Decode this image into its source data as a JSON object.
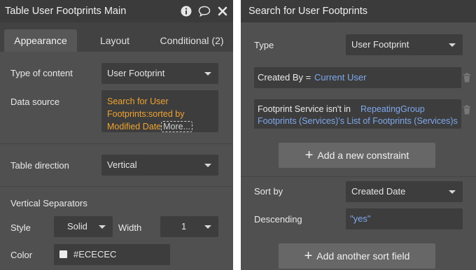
{
  "left_panel": {
    "title": "Table User Footprints Main",
    "tabs": [
      "Appearance",
      "Layout",
      "Conditional (2)"
    ],
    "type_of_content_label": "Type of content",
    "type_of_content_value": "User Footprint",
    "data_source_label": "Data source",
    "data_source_value": "Search for User Footprints:sorted by Modified Date",
    "data_source_line1": "Search for User",
    "data_source_line2": "Footprints:sorted by",
    "data_source_line3": "Modified Date",
    "more_link": "More...",
    "table_direction_label": "Table direction",
    "table_direction_value": "Vertical",
    "vertical_separators_label": "Vertical Separators",
    "style_label": "Style",
    "style_value": "Solid",
    "width_label": "Width",
    "width_value": "1",
    "color_label": "Color",
    "color_value": "#ECECEC"
  },
  "right_panel": {
    "title": "Search for User Footprints",
    "type_label": "Type",
    "type_value": "User Footprint",
    "constraint1_label": "Created By =",
    "constraint1_value": "Current User",
    "constraint2_label": "Footprint Service isn't in",
    "constraint2_value_part1": "RepeatingGroup",
    "constraint2_value_part2": "Footprints (Services)'s List of Footprints (Services)s",
    "add_constraint_label": "Add a new constraint",
    "sort_by_label": "Sort by",
    "sort_by_value": "Created Date",
    "descending_label": "Descending",
    "descending_value": "\"yes\"",
    "add_sort_label": "Add another sort field"
  },
  "colors": {
    "panel_bg": "#505050",
    "titlebar_bg": "#3b3b3b",
    "field_bg": "#3d3d3d",
    "expression_orange": "#f0a330",
    "expression_blue": "#7fa8ee",
    "color_swatch": "#ECECEC"
  },
  "icons": {
    "info": "info-icon",
    "comment": "comment-icon",
    "close": "close-icon",
    "trash": "trash-icon",
    "dropdown": "chevron-down-icon",
    "plus": "plus-icon"
  }
}
